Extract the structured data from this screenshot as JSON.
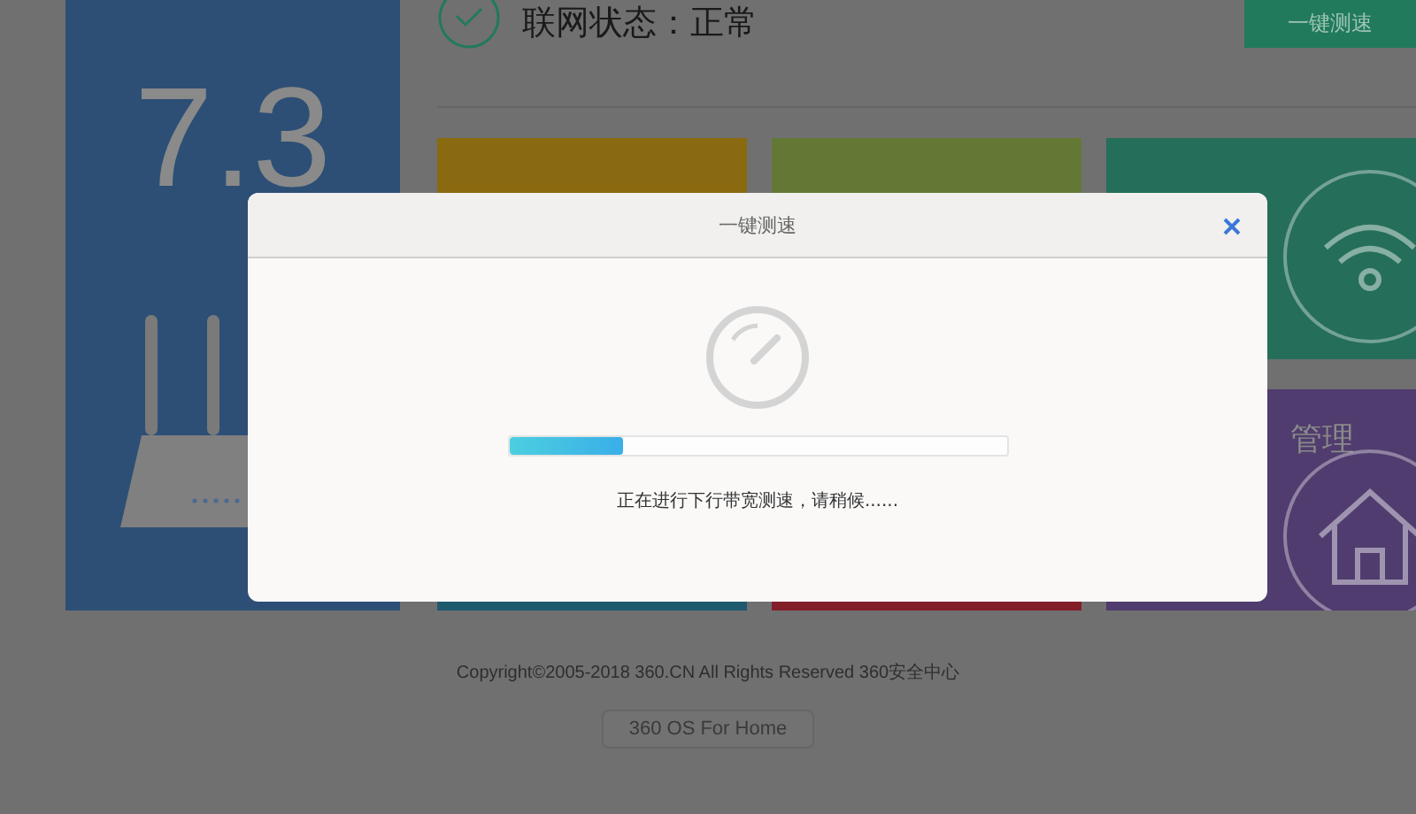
{
  "speed_panel": {
    "speed": "7.3"
  },
  "status": {
    "text": "联网状态：正常"
  },
  "speed_test_button": "一键测速",
  "tiles": [
    {
      "color": "#8a6a10",
      "kind": "plain"
    },
    {
      "color": "#647836",
      "kind": "plain"
    },
    {
      "color": "#256e5a",
      "kind": "wifi"
    },
    {
      "color": "#1e5a6e",
      "kind": "plain"
    },
    {
      "color": "#821e28",
      "kind": "plain"
    },
    {
      "color": "#503c6e",
      "kind": "home",
      "title": "管理"
    }
  ],
  "footer": {
    "copyright": "Copyright©2005-2018 360.CN All Rights Reserved 360安全中心",
    "button": "360 OS For Home"
  },
  "dialog": {
    "title": "一键测速",
    "progress": {
      "level": 0.23
    },
    "message": "正在进行下行带宽测速，请稍候......"
  }
}
